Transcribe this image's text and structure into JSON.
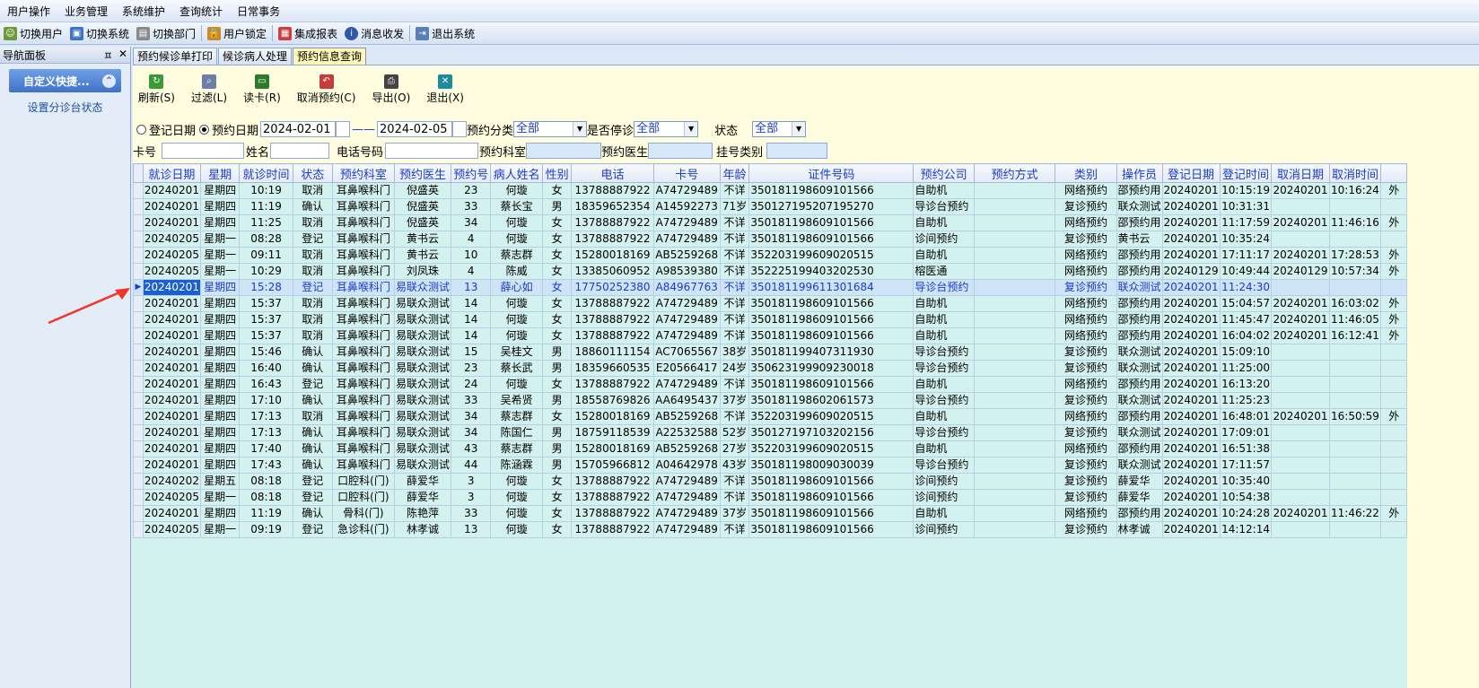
{
  "menu": [
    "用户操作",
    "业务管理",
    "系统维护",
    "查询统计",
    "日常事务"
  ],
  "toolbar": [
    "切换用户",
    "切换系统",
    "切换部门",
    "用户锁定",
    "集成报表",
    "消息收发",
    "退出系统"
  ],
  "nav": {
    "title": "导航面板",
    "pin": "ㅍ",
    "close": "✕",
    "group": "自定义快捷...",
    "item": "设置分诊台状态"
  },
  "tabs": [
    "预约候诊单打印",
    "候诊病人处理",
    "预约信息查询"
  ],
  "actions": [
    "刷新(S)",
    "过滤(L)",
    "读卡(R)",
    "取消预约(C)",
    "导出(O)",
    "退出(X)"
  ],
  "filters": {
    "radio1": "登记日期",
    "radio2": "预约日期",
    "date_from": "2024-02-01",
    "dash": "——",
    "date_to": "2024-02-05",
    "cat_label": "预约分类",
    "cat_value": "全部",
    "stop_label": "是否停诊",
    "stop_value": "全部",
    "status_label": "状态",
    "status_value": "全部",
    "card_label": "卡号",
    "name_label": "姓名",
    "phone_label": "电话号码",
    "dept_label": "预约科室",
    "doctor_label": "预约医生",
    "regtype_label": "挂号类别"
  },
  "columns": [
    "就诊日期",
    "星期",
    "就诊时间",
    "状态",
    "预约科室",
    "预约医生",
    "预约号",
    "病人姓名",
    "性别",
    "电话",
    "卡号",
    "年龄",
    "证件号码",
    "预约公司",
    "预约方式",
    "类别",
    "操作员",
    "登记日期",
    "登记时间",
    "取消日期",
    "取消时间",
    ""
  ],
  "rows": [
    [
      "20240201",
      "星期四",
      "10:19",
      "取消",
      "耳鼻喉科门",
      "倪盛英",
      "23",
      "何璇",
      "女",
      "13788887922",
      "A74729489",
      "不详",
      "350181198609101566",
      "自助机",
      "",
      "网络预约",
      "邵预约用",
      "20240201",
      "10:15:19",
      "20240201",
      "10:16:24",
      "外"
    ],
    [
      "20240201",
      "星期四",
      "11:19",
      "确认",
      "耳鼻喉科门",
      "倪盛英",
      "33",
      "蔡长宝",
      "男",
      "18359652354",
      "A14592273",
      "71岁",
      "350127195207195270",
      "导诊台预约",
      "",
      "复诊预约",
      "联众测试",
      "20240201",
      "10:31:31",
      "",
      "",
      ""
    ],
    [
      "20240201",
      "星期四",
      "11:25",
      "取消",
      "耳鼻喉科门",
      "倪盛英",
      "34",
      "何璇",
      "女",
      "13788887922",
      "A74729489",
      "不详",
      "350181198609101566",
      "自助机",
      "",
      "网络预约",
      "邵预约用",
      "20240201",
      "11:17:59",
      "20240201",
      "11:46:16",
      "外"
    ],
    [
      "20240205",
      "星期一",
      "08:28",
      "登记",
      "耳鼻喉科门",
      "黄书云",
      "4",
      "何璇",
      "女",
      "13788887922",
      "A74729489",
      "不详",
      "350181198609101566",
      "诊间预约",
      "",
      "复诊预约",
      "黄书云",
      "20240201",
      "10:35:24",
      "",
      "",
      ""
    ],
    [
      "20240205",
      "星期一",
      "09:11",
      "取消",
      "耳鼻喉科门",
      "黄书云",
      "10",
      "蔡志群",
      "女",
      "15280018169",
      "AB5259268",
      "不详",
      "352203199609020515",
      "自助机",
      "",
      "网络预约",
      "邵预约用",
      "20240201",
      "17:11:17",
      "20240201",
      "17:28:53",
      "外"
    ],
    [
      "20240205",
      "星期一",
      "10:29",
      "取消",
      "耳鼻喉科门",
      "刘凤珠",
      "4",
      "陈威",
      "女",
      "13385060952",
      "A98539380",
      "不详",
      "352225199403202530",
      "榕医通",
      "",
      "网络预约",
      "邵预约用",
      "20240129",
      "10:49:44",
      "20240129",
      "10:57:34",
      "外"
    ],
    [
      "20240201",
      "星期四",
      "15:28",
      "登记",
      "耳鼻喉科门",
      "易联众测试",
      "13",
      "薛心如",
      "女",
      "17750252380",
      "A84967763",
      "不详",
      "350181199611301684",
      "导诊台预约",
      "",
      "复诊预约",
      "联众测试",
      "20240201",
      "11:24:30",
      "",
      "",
      ""
    ],
    [
      "20240201",
      "星期四",
      "15:37",
      "取消",
      "耳鼻喉科门",
      "易联众测试",
      "14",
      "何璇",
      "女",
      "13788887922",
      "A74729489",
      "不详",
      "350181198609101566",
      "自助机",
      "",
      "网络预约",
      "邵预约用",
      "20240201",
      "15:04:57",
      "20240201",
      "16:03:02",
      "外"
    ],
    [
      "20240201",
      "星期四",
      "15:37",
      "取消",
      "耳鼻喉科门",
      "易联众测试",
      "14",
      "何璇",
      "女",
      "13788887922",
      "A74729489",
      "不详",
      "350181198609101566",
      "自助机",
      "",
      "网络预约",
      "邵预约用",
      "20240201",
      "11:45:47",
      "20240201",
      "11:46:05",
      "外"
    ],
    [
      "20240201",
      "星期四",
      "15:37",
      "取消",
      "耳鼻喉科门",
      "易联众测试",
      "14",
      "何璇",
      "女",
      "13788887922",
      "A74729489",
      "不详",
      "350181198609101566",
      "自助机",
      "",
      "网络预约",
      "邵预约用",
      "20240201",
      "16:04:02",
      "20240201",
      "16:12:41",
      "外"
    ],
    [
      "20240201",
      "星期四",
      "15:46",
      "确认",
      "耳鼻喉科门",
      "易联众测试",
      "15",
      "吴桂文",
      "男",
      "18860111154",
      "AC7065567",
      "38岁",
      "350181199407311930",
      "导诊台预约",
      "",
      "复诊预约",
      "联众测试",
      "20240201",
      "15:09:10",
      "",
      "",
      ""
    ],
    [
      "20240201",
      "星期四",
      "16:40",
      "确认",
      "耳鼻喉科门",
      "易联众测试",
      "23",
      "蔡长武",
      "男",
      "18359660535",
      "E20566417",
      "24岁",
      "350623199909230018",
      "导诊台预约",
      "",
      "复诊预约",
      "联众测试",
      "20240201",
      "11:25:00",
      "",
      "",
      ""
    ],
    [
      "20240201",
      "星期四",
      "16:43",
      "登记",
      "耳鼻喉科门",
      "易联众测试",
      "24",
      "何璇",
      "女",
      "13788887922",
      "A74729489",
      "不详",
      "350181198609101566",
      "自助机",
      "",
      "网络预约",
      "邵预约用",
      "20240201",
      "16:13:20",
      "",
      "",
      ""
    ],
    [
      "20240201",
      "星期四",
      "17:10",
      "确认",
      "耳鼻喉科门",
      "易联众测试",
      "33",
      "吴希贤",
      "男",
      "18558769826",
      "AA6495437",
      "37岁",
      "350181198602061573",
      "导诊台预约",
      "",
      "复诊预约",
      "联众测试",
      "20240201",
      "11:25:23",
      "",
      "",
      ""
    ],
    [
      "20240201",
      "星期四",
      "17:13",
      "取消",
      "耳鼻喉科门",
      "易联众测试",
      "34",
      "蔡志群",
      "女",
      "15280018169",
      "AB5259268",
      "不详",
      "352203199609020515",
      "自助机",
      "",
      "网络预约",
      "邵预约用",
      "20240201",
      "16:48:01",
      "20240201",
      "16:50:59",
      "外"
    ],
    [
      "20240201",
      "星期四",
      "17:13",
      "确认",
      "耳鼻喉科门",
      "易联众测试",
      "34",
      "陈国仁",
      "男",
      "18759118539",
      "A22532588",
      "52岁",
      "350127197103202156",
      "导诊台预约",
      "",
      "复诊预约",
      "联众测试",
      "20240201",
      "17:09:01",
      "",
      "",
      ""
    ],
    [
      "20240201",
      "星期四",
      "17:40",
      "确认",
      "耳鼻喉科门",
      "易联众测试",
      "43",
      "蔡志群",
      "男",
      "15280018169",
      "AB5259268",
      "27岁",
      "352203199609020515",
      "自助机",
      "",
      "网络预约",
      "邵预约用",
      "20240201",
      "16:51:38",
      "",
      "",
      ""
    ],
    [
      "20240201",
      "星期四",
      "17:43",
      "确认",
      "耳鼻喉科门",
      "易联众测试",
      "44",
      "陈涵霖",
      "男",
      "15705966812",
      "A04642978",
      "43岁",
      "350181198009030039",
      "导诊台预约",
      "",
      "复诊预约",
      "联众测试",
      "20240201",
      "17:11:57",
      "",
      "",
      ""
    ],
    [
      "20240202",
      "星期五",
      "08:18",
      "登记",
      "口腔科(门)",
      "薛爱华",
      "3",
      "何璇",
      "女",
      "13788887922",
      "A74729489",
      "不详",
      "350181198609101566",
      "诊间预约",
      "",
      "复诊预约",
      "薛爱华",
      "20240201",
      "10:35:40",
      "",
      "",
      ""
    ],
    [
      "20240205",
      "星期一",
      "08:18",
      "登记",
      "口腔科(门)",
      "薛爱华",
      "3",
      "何璇",
      "女",
      "13788887922",
      "A74729489",
      "不详",
      "350181198609101566",
      "诊间预约",
      "",
      "复诊预约",
      "薛爱华",
      "20240201",
      "10:54:38",
      "",
      "",
      ""
    ],
    [
      "20240201",
      "星期四",
      "11:19",
      "确认",
      "骨科(门)",
      "陈艳萍",
      "33",
      "何璇",
      "女",
      "13788887922",
      "A74729489",
      "37岁",
      "350181198609101566",
      "自助机",
      "",
      "网络预约",
      "邵预约用",
      "20240201",
      "10:24:28",
      "20240201",
      "11:46:22",
      "外"
    ],
    [
      "20240205",
      "星期一",
      "09:19",
      "登记",
      "急诊科(门)",
      "林孝诚",
      "13",
      "何璇",
      "女",
      "13788887922",
      "A74729489",
      "不详",
      "350181198609101566",
      "诊间预约",
      "",
      "复诊预约",
      "林孝诚",
      "20240201",
      "14:12:14",
      "",
      "",
      ""
    ]
  ],
  "selected_row": 6
}
